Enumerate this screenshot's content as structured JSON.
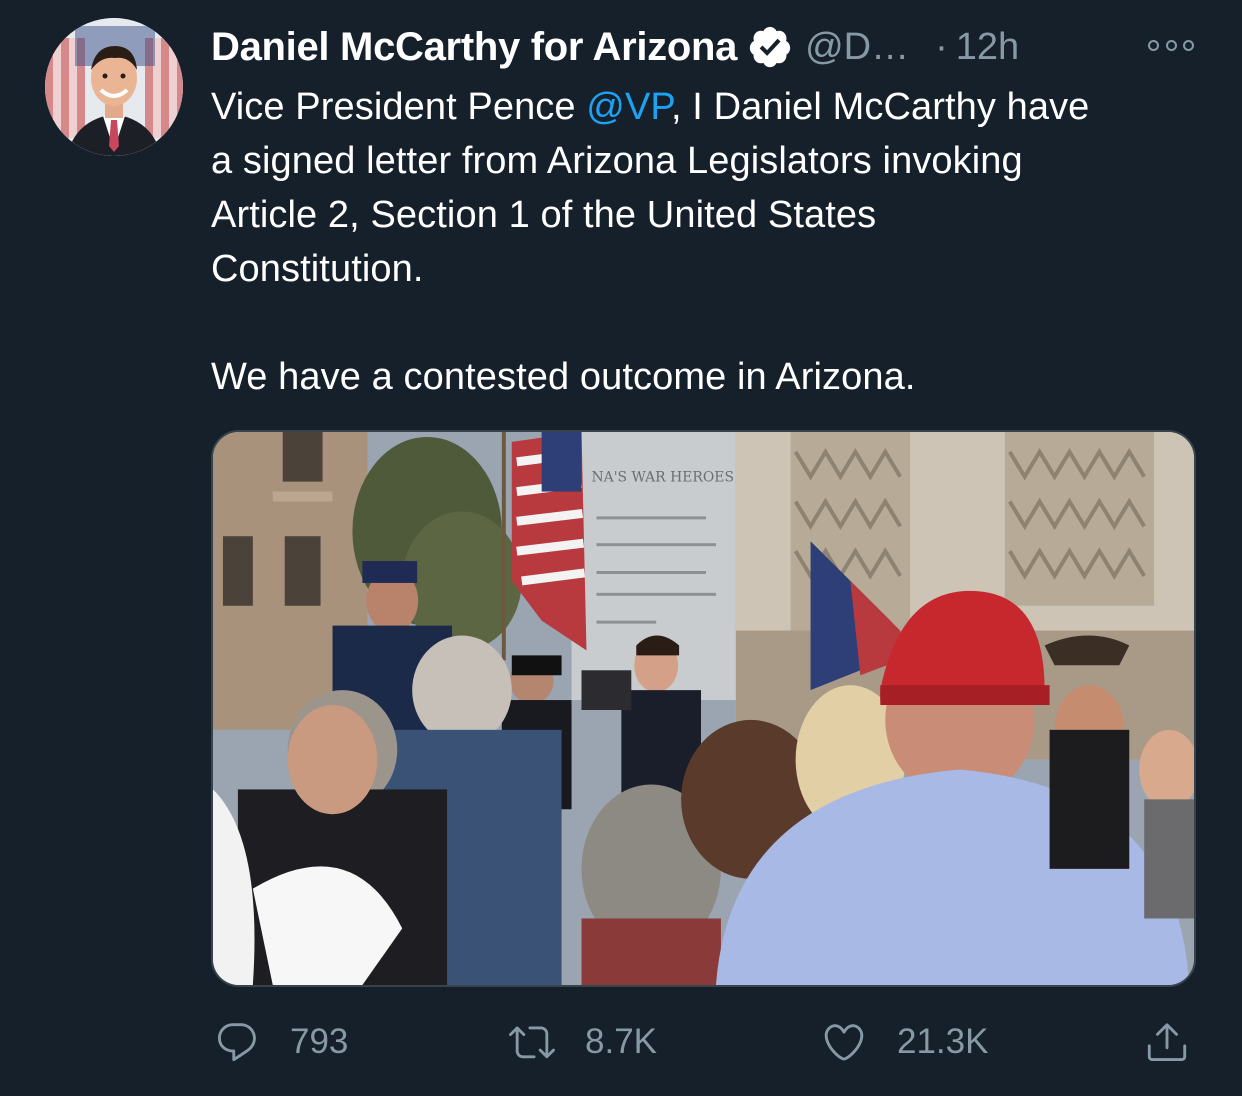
{
  "tweet": {
    "display_name": "Daniel McCarthy for Arizona",
    "handle": "@D…",
    "separator": "·",
    "time": "12h",
    "verified_icon": "verified-badge-icon",
    "more_icon": "more-options-icon",
    "text": {
      "line1_a": "Vice President Pence ",
      "mention": "@VP",
      "line1_b": ", I Daniel McCarthy have",
      "line2": "a signed letter from Arizona Legislators invoking",
      "line3": "Article 2, Section 1 of the United States",
      "line4": "Constitution.",
      "line5": "We have a contested outcome in Arizona."
    },
    "photo": {
      "monument_lines": [
        "NA'S WAR HEROES"
      ]
    },
    "actions": {
      "reply_count": "793",
      "retweet_count": "8.7K",
      "like_count": "21.3K"
    }
  },
  "colors": {
    "background": "#15202b",
    "secondary_text": "#8899a6",
    "link": "#1da1f2",
    "border": "#38444d"
  }
}
